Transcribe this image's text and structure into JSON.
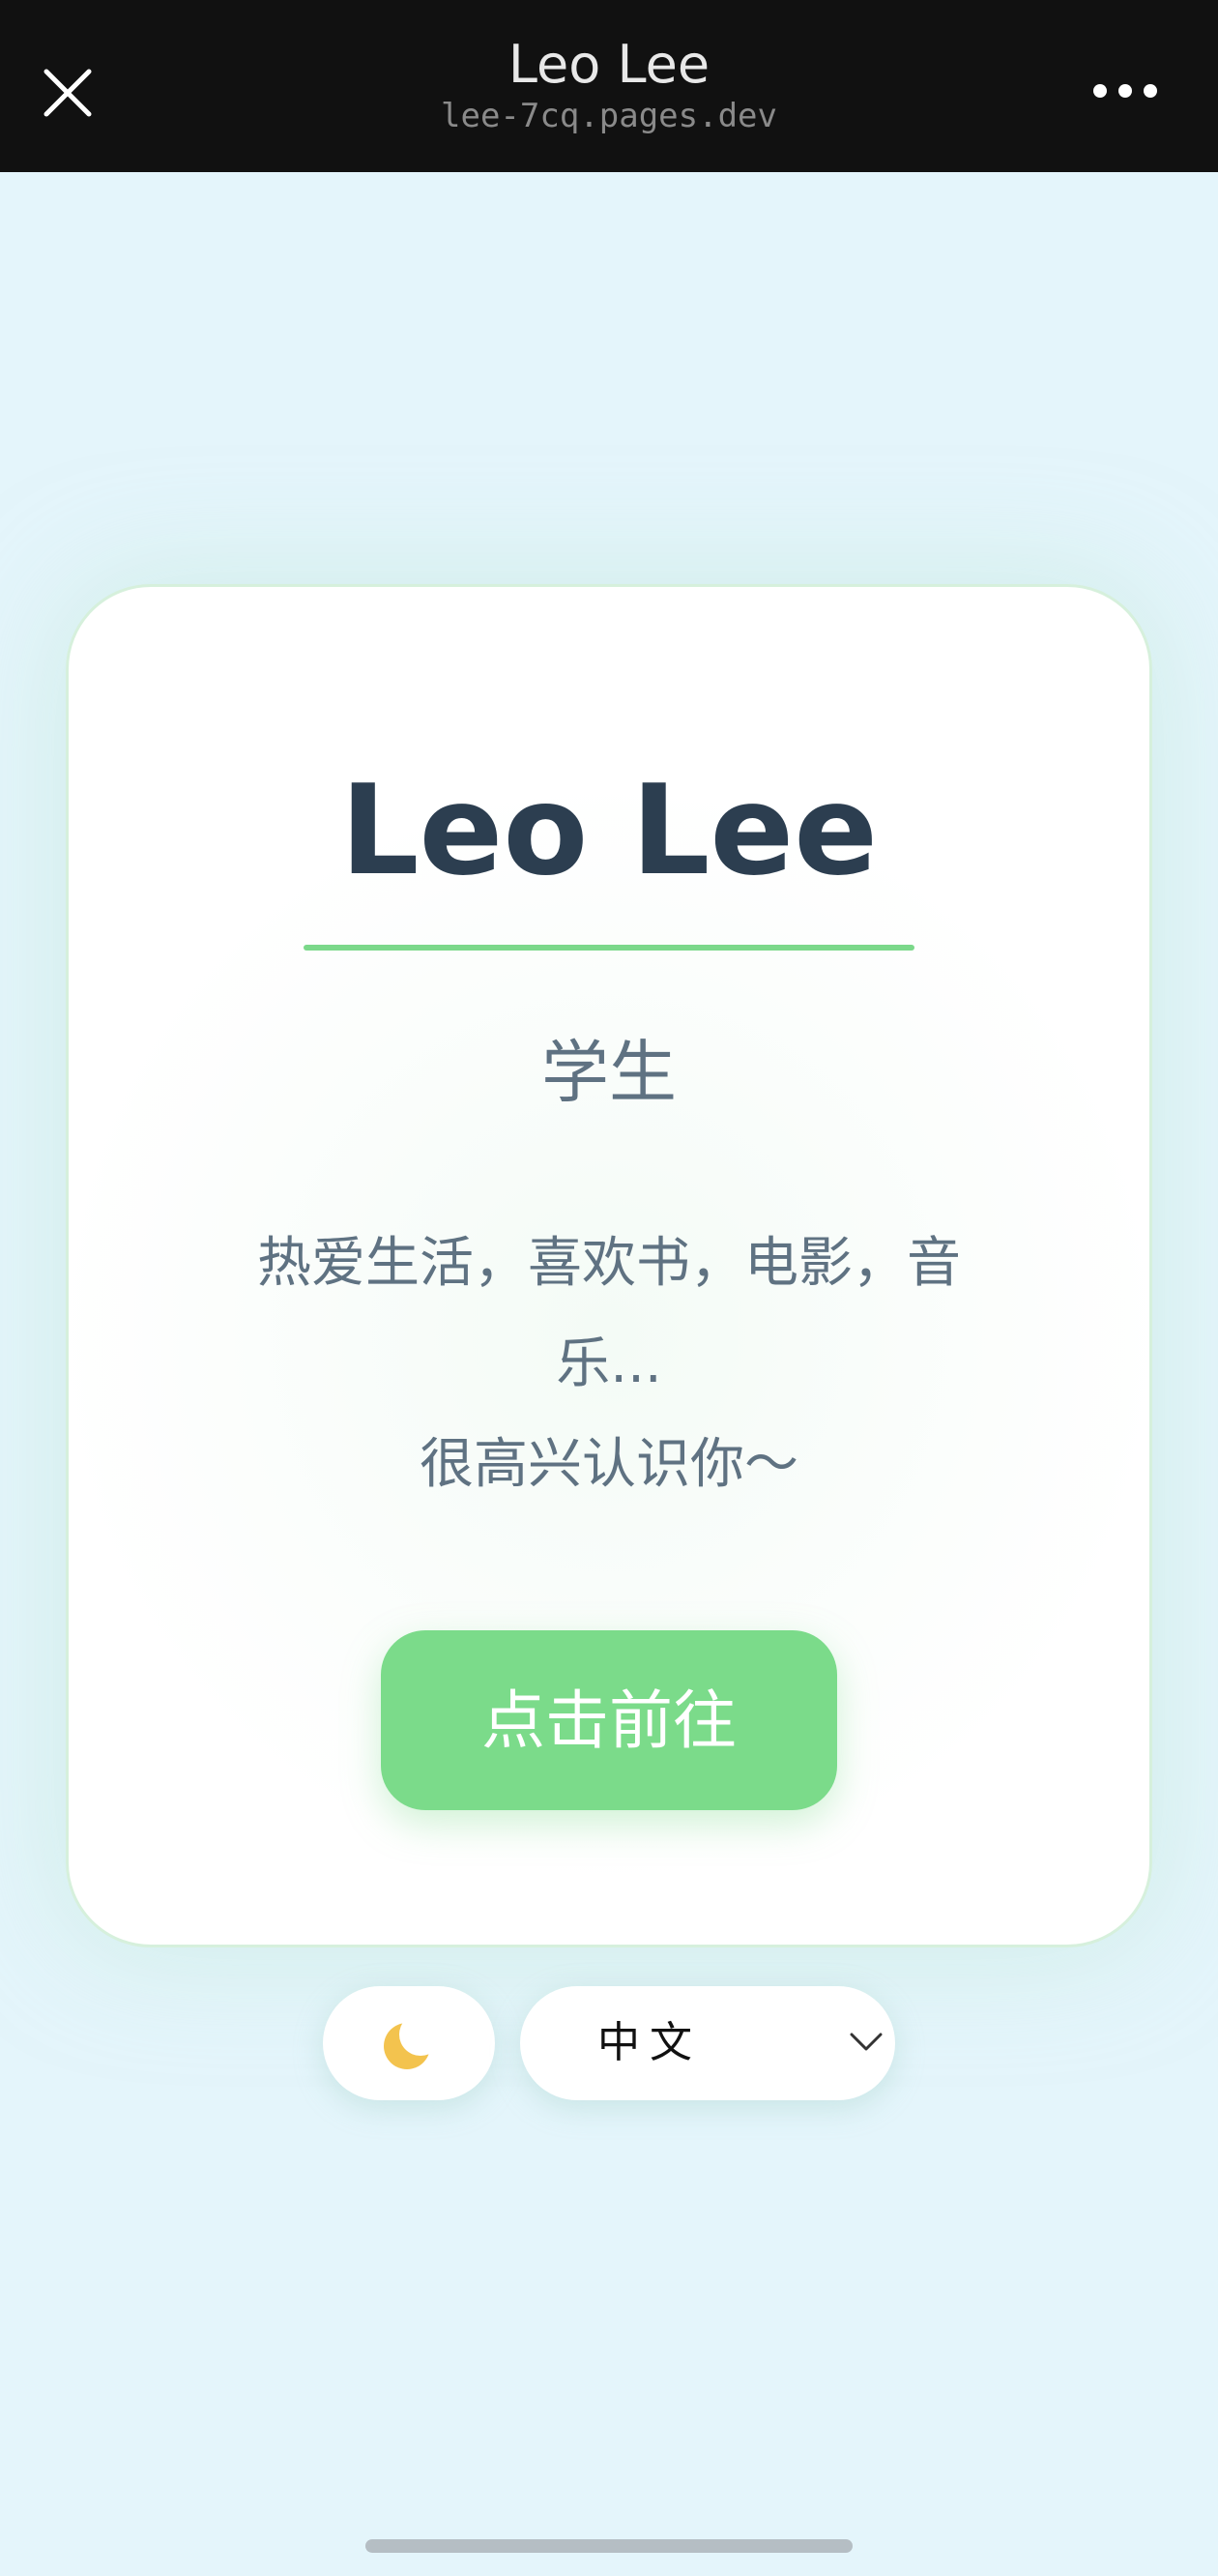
{
  "window": {
    "title": "Leo Lee",
    "url": "lee-7cq.pages.dev"
  },
  "profile": {
    "name": "Leo Lee",
    "role": "学生",
    "bio_lines": [
      "热爱生活，喜欢书，电影，音",
      "乐...",
      "很高兴认识你～"
    ],
    "cta_label": "点击前往"
  },
  "controls": {
    "theme_icon": "moon-icon",
    "theme_glyph": "🌙",
    "language": "中文"
  },
  "colors": {
    "background": "#e4f5fb",
    "accent": "#7bdb8a",
    "heading": "#2c3e50",
    "text": "#5f7282"
  }
}
